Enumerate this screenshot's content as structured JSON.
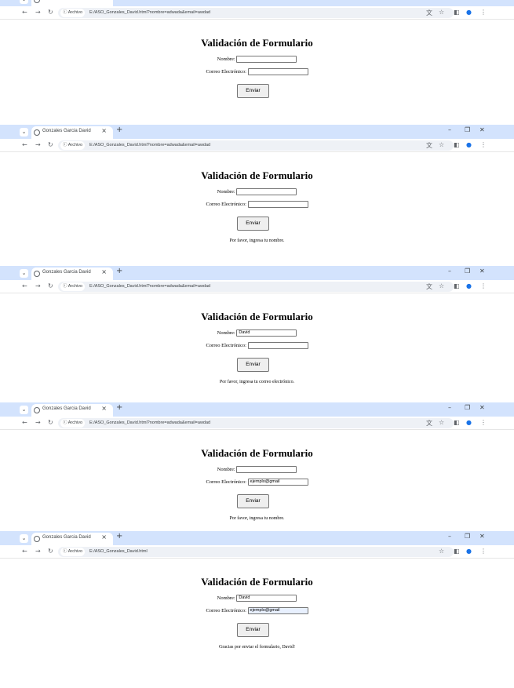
{
  "browser": {
    "tab_title": "Gonzales Garcia David",
    "chip_label": "ⓘ Archivo",
    "url_with_query": "E:/ASO_Gonzales_David.html?nombre=adwada&email=awdad",
    "url_plain": "E:/ASO_Gonzales_David.html",
    "icons": [
      "chevron-down-icon",
      "globe-icon",
      "close-icon",
      "plus-icon",
      "minimize-icon",
      "restore-icon",
      "close-window-icon",
      "back-icon",
      "forward-icon",
      "reload-icon",
      "translate-icon",
      "star-icon",
      "side-panel-icon",
      "profile-icon",
      "kebab-menu-icon"
    ]
  },
  "form": {
    "title": "Validación de Formulario",
    "name_label": "Nombre:",
    "email_label": "Correo Electrónico:",
    "submit_label": "Enviar"
  },
  "screens": [
    {
      "name_value": "",
      "email_value": "",
      "message": ""
    },
    {
      "name_value": "",
      "email_value": "",
      "message": "Por favor, ingresa tu nombre."
    },
    {
      "name_value": "David",
      "email_value": "",
      "message": "Por favor, ingresa tu correo electrónico."
    },
    {
      "name_value": "",
      "email_value": "ejemplo@gmail",
      "message": "Por favor, ingresa tu nombre."
    },
    {
      "name_value": "David",
      "email_value": "ejemplo@gmail",
      "message": "Gracias por enviar el formulario, David!"
    }
  ]
}
